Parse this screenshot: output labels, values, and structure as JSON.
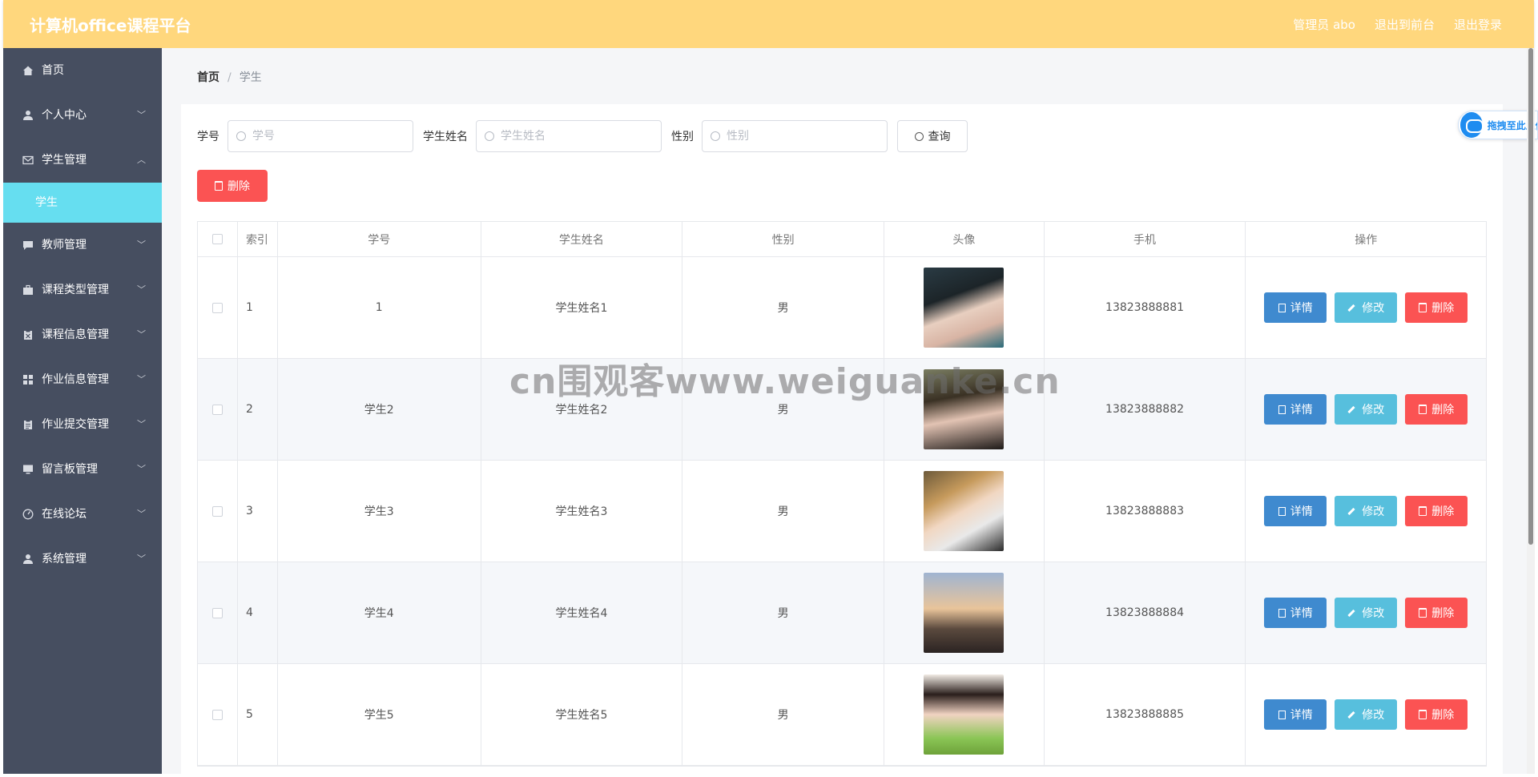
{
  "app": {
    "title": "计算机office课程平台"
  },
  "top_links": {
    "user": "管理员 abo",
    "to_front": "退出到前台",
    "logout": "退出登录"
  },
  "sidebar": {
    "items": [
      {
        "label": "首页",
        "icon": "home-icon",
        "has_children": false
      },
      {
        "label": "个人中心",
        "icon": "user-icon",
        "has_children": true
      },
      {
        "label": "学生管理",
        "icon": "mail-icon",
        "has_children": true,
        "expanded": true
      },
      {
        "label": "学生",
        "sub": true,
        "active": true
      },
      {
        "label": "教师管理",
        "icon": "chat-icon",
        "has_children": true
      },
      {
        "label": "课程类型管理",
        "icon": "briefcase-icon",
        "has_children": true
      },
      {
        "label": "课程信息管理",
        "icon": "clipboard-icon",
        "has_children": true
      },
      {
        "label": "作业信息管理",
        "icon": "grid-icon",
        "has_children": true
      },
      {
        "label": "作业提交管理",
        "icon": "clipboard-list-icon",
        "has_children": true
      },
      {
        "label": "留言板管理",
        "icon": "monitor-icon",
        "has_children": true
      },
      {
        "label": "在线论坛",
        "icon": "compass-icon",
        "has_children": true
      },
      {
        "label": "系统管理",
        "icon": "user-icon",
        "has_children": true
      }
    ]
  },
  "breadcrumb": {
    "home": "首页",
    "sep": "/",
    "current": "学生"
  },
  "search": {
    "id_label": "学号",
    "id_placeholder": "学号",
    "name_label": "学生姓名",
    "name_placeholder": "学生姓名",
    "gender_label": "性别",
    "gender_placeholder": "性别",
    "query_label": "查询"
  },
  "toolbar": {
    "delete_label": "删除"
  },
  "table": {
    "headers": [
      "索引",
      "学号",
      "学生姓名",
      "性别",
      "头像",
      "手机",
      "操作"
    ],
    "rows": [
      {
        "index": "1",
        "id": "1",
        "name": "学生姓名1",
        "gender": "男",
        "phone": "13823888881"
      },
      {
        "index": "2",
        "id": "学生2",
        "name": "学生姓名2",
        "gender": "男",
        "phone": "13823888882"
      },
      {
        "index": "3",
        "id": "学生3",
        "name": "学生姓名3",
        "gender": "男",
        "phone": "13823888883"
      },
      {
        "index": "4",
        "id": "学生4",
        "name": "学生姓名4",
        "gender": "男",
        "phone": "13823888884"
      },
      {
        "index": "5",
        "id": "学生5",
        "name": "学生姓名5",
        "gender": "男",
        "phone": "13823888885"
      }
    ],
    "actions": {
      "detail": "详情",
      "edit": "修改",
      "delete": "删除"
    }
  },
  "watermark": "cn围观客www.weiguanke.cn",
  "float_button": {
    "label": "拖拽至此上传"
  },
  "colors": {
    "topbar": "#ffd77d",
    "sidebar": "#464e60",
    "active_sub": "#66def0",
    "danger": "#fb5353",
    "primary": "#3f8acf",
    "info": "#57bfdd"
  }
}
